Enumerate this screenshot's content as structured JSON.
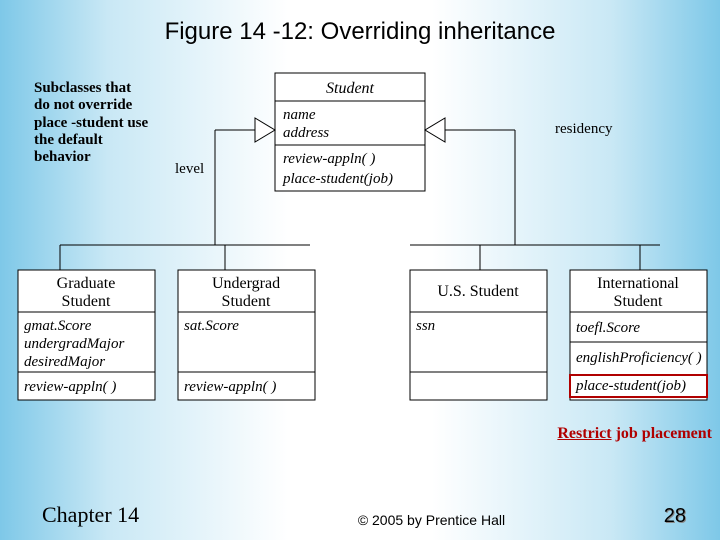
{
  "title": "Figure 14 -12: Overriding inheritance",
  "annotations": {
    "left": "Subclasses that do not override place -student use the default behavior",
    "right_a": "Restrict",
    "right_b": " job placement"
  },
  "roles": {
    "left": "level",
    "right": "residency"
  },
  "parent": {
    "name": "Student",
    "attrs": [
      "name",
      "address"
    ],
    "ops": [
      "review-appln( )",
      "place-student(job)"
    ]
  },
  "children": [
    {
      "name1": "Graduate",
      "name2": "Student",
      "attrs": [
        "gmat.Score",
        "undergradMajor",
        "desiredMajor"
      ],
      "ops": [
        "review-appln( )"
      ]
    },
    {
      "name1": "Undergrad",
      "name2": "Student",
      "attrs": [
        "sat.Score"
      ],
      "ops": [
        "review-appln( )"
      ]
    },
    {
      "name1": "U.S. Student",
      "name2": "",
      "attrs": [
        "ssn"
      ],
      "ops": []
    },
    {
      "name1": "International",
      "name2": "Student",
      "attrs": [
        "toefl.Score"
      ],
      "ops": [
        "englishProficiency( )",
        "place-student(job)"
      ]
    }
  ],
  "footer": {
    "chapter": "Chapter 14",
    "copy": "© 2005 by Prentice Hall",
    "page": "28"
  }
}
